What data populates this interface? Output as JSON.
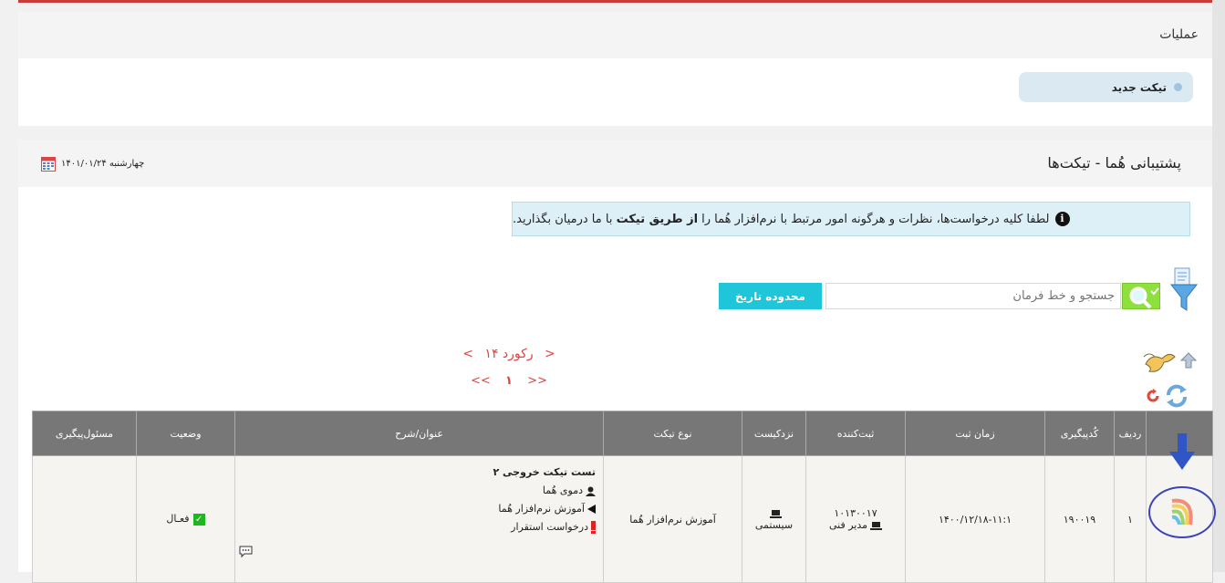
{
  "operations": {
    "title": "عملیات",
    "new_ticket_label": "تیکت جدید"
  },
  "tickets_panel": {
    "title": "پشتیبانی هُما - تیکت‌ها",
    "date": "چهارشنبه ۱۴۰۱/۰۱/۲۴",
    "info_pre": "لطفا کلیه درخواست‌ها، نظرات و هرگونه امور مرتبط با نرم‌افزار هُما را ",
    "info_bold": "از طریق تیکت",
    "info_post": " با ما درمیان بگذارید."
  },
  "search": {
    "placeholder": "جستجو و خط فرمان",
    "date_range_label": "محدوده تاریخ"
  },
  "pagination": {
    "records_label": "۱۴ رکورد",
    "prev": "<",
    "next": ">",
    "first": "<<",
    "last": ">>",
    "current_page": "۱"
  },
  "table": {
    "headers": [
      "ردیف",
      "کُدپیگیری",
      "زمان ثبت",
      "ثبت‌کننده",
      "نزدکیست",
      "نوع تیکت",
      "عنوان/شرح",
      "وضعیت",
      "مسئول‌پیگیری"
    ],
    "rows": [
      {
        "index": "۱",
        "tracking_code": "۱۹۰۰۱۹",
        "registered_at": "۱۴۰۰/۱۲/۱۸-۱۱:۱",
        "registrar_code": "۱۰۱۳۰۰۱۷",
        "registrar_name": "مدیر فنی",
        "with_whom": "سیستمی",
        "ticket_type": "آموزش نرم‌افزار هُما",
        "title": "تست تیکت خروجی ۲",
        "customer": "دموی هُما",
        "category": "آموزش نرم‌افزار هُما",
        "request_type": "درخواست استقرار",
        "status": "فعـال",
        "responsible": ""
      }
    ]
  },
  "colors": {
    "accent_red": "#c73b3b",
    "search_green": "#8ee03c",
    "date_range_cyan": "#1fc5d8",
    "header_gray": "#777777",
    "highlight_blue": "#3a46b8"
  }
}
